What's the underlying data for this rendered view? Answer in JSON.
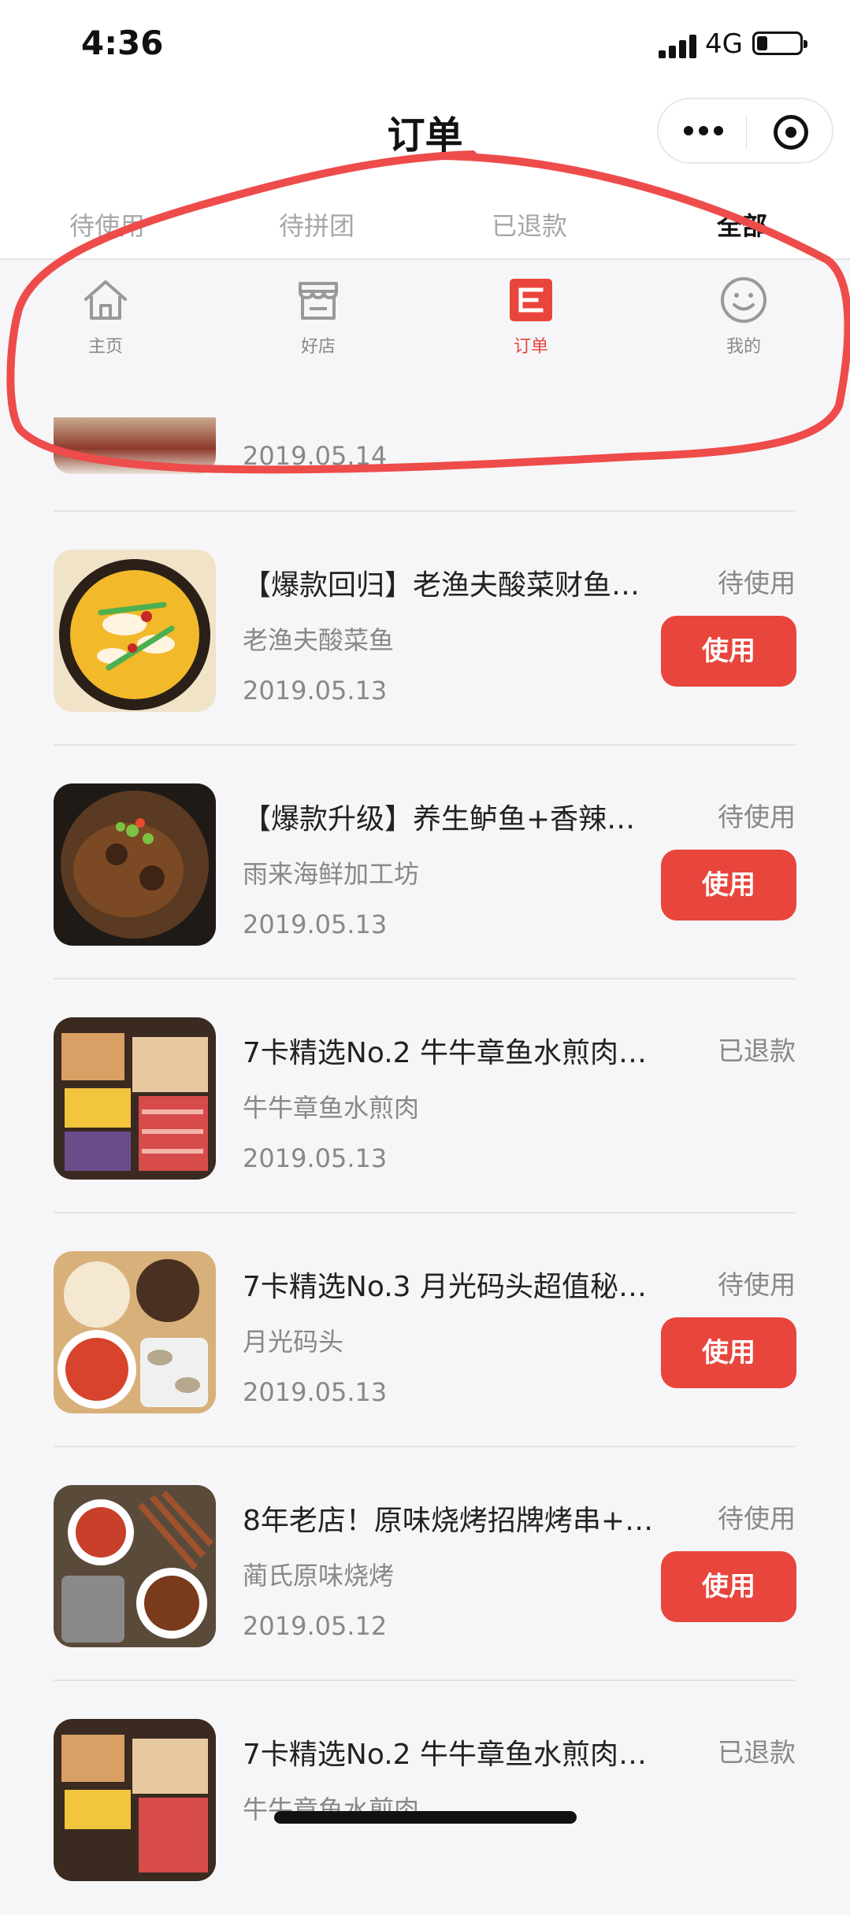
{
  "status_bar": {
    "time": "4:36",
    "network": "4G",
    "battery_level": 0.25
  },
  "nav": {
    "title": "订单"
  },
  "tabs": [
    {
      "label": "待使用",
      "active": false
    },
    {
      "label": "待拼团",
      "active": false
    },
    {
      "label": "已退款",
      "active": false
    },
    {
      "label": "全部",
      "active": true
    }
  ],
  "bottom_nav": [
    {
      "label": "主页",
      "icon": "home-icon"
    },
    {
      "label": "好店",
      "icon": "shop-icon"
    },
    {
      "label": "订单",
      "icon": "order-icon",
      "active": true
    },
    {
      "label": "我的",
      "icon": "profile-icon"
    }
  ],
  "orders": {
    "partial": {
      "date": "2019.05.14"
    },
    "use_label": "使用",
    "items": [
      {
        "title": "【爆款回归】老渔夫酸菜财鱼…",
        "status": "待使用",
        "shop": "老渔夫酸菜鱼",
        "date": "2019.05.13"
      },
      {
        "title": "【爆款升级】养生鲈鱼+香辣…",
        "status": "待使用",
        "shop": "雨来海鲜加工坊",
        "date": "2019.05.13"
      },
      {
        "title": "7卡精选No.2 牛牛章鱼水煎肉…",
        "status": "已退款",
        "shop": "牛牛章鱼水煎肉",
        "date": "2019.05.13"
      },
      {
        "title": "7卡精选No.3 月光码头超值秘…",
        "status": "待使用",
        "shop": "月光码头",
        "date": "2019.05.13"
      },
      {
        "title": "8年老店！原味烧烤招牌烤串+…",
        "status": "待使用",
        "shop": "蔺氏原味烧烤",
        "date": "2019.05.12"
      },
      {
        "title": "7卡精选No.2 牛牛章鱼水煎肉…",
        "status": "已退款",
        "shop": "牛牛章鱼水煎肉",
        "date": ""
      }
    ]
  },
  "colors": {
    "accent": "#e8453c",
    "annotation": "#ee4b4b"
  }
}
